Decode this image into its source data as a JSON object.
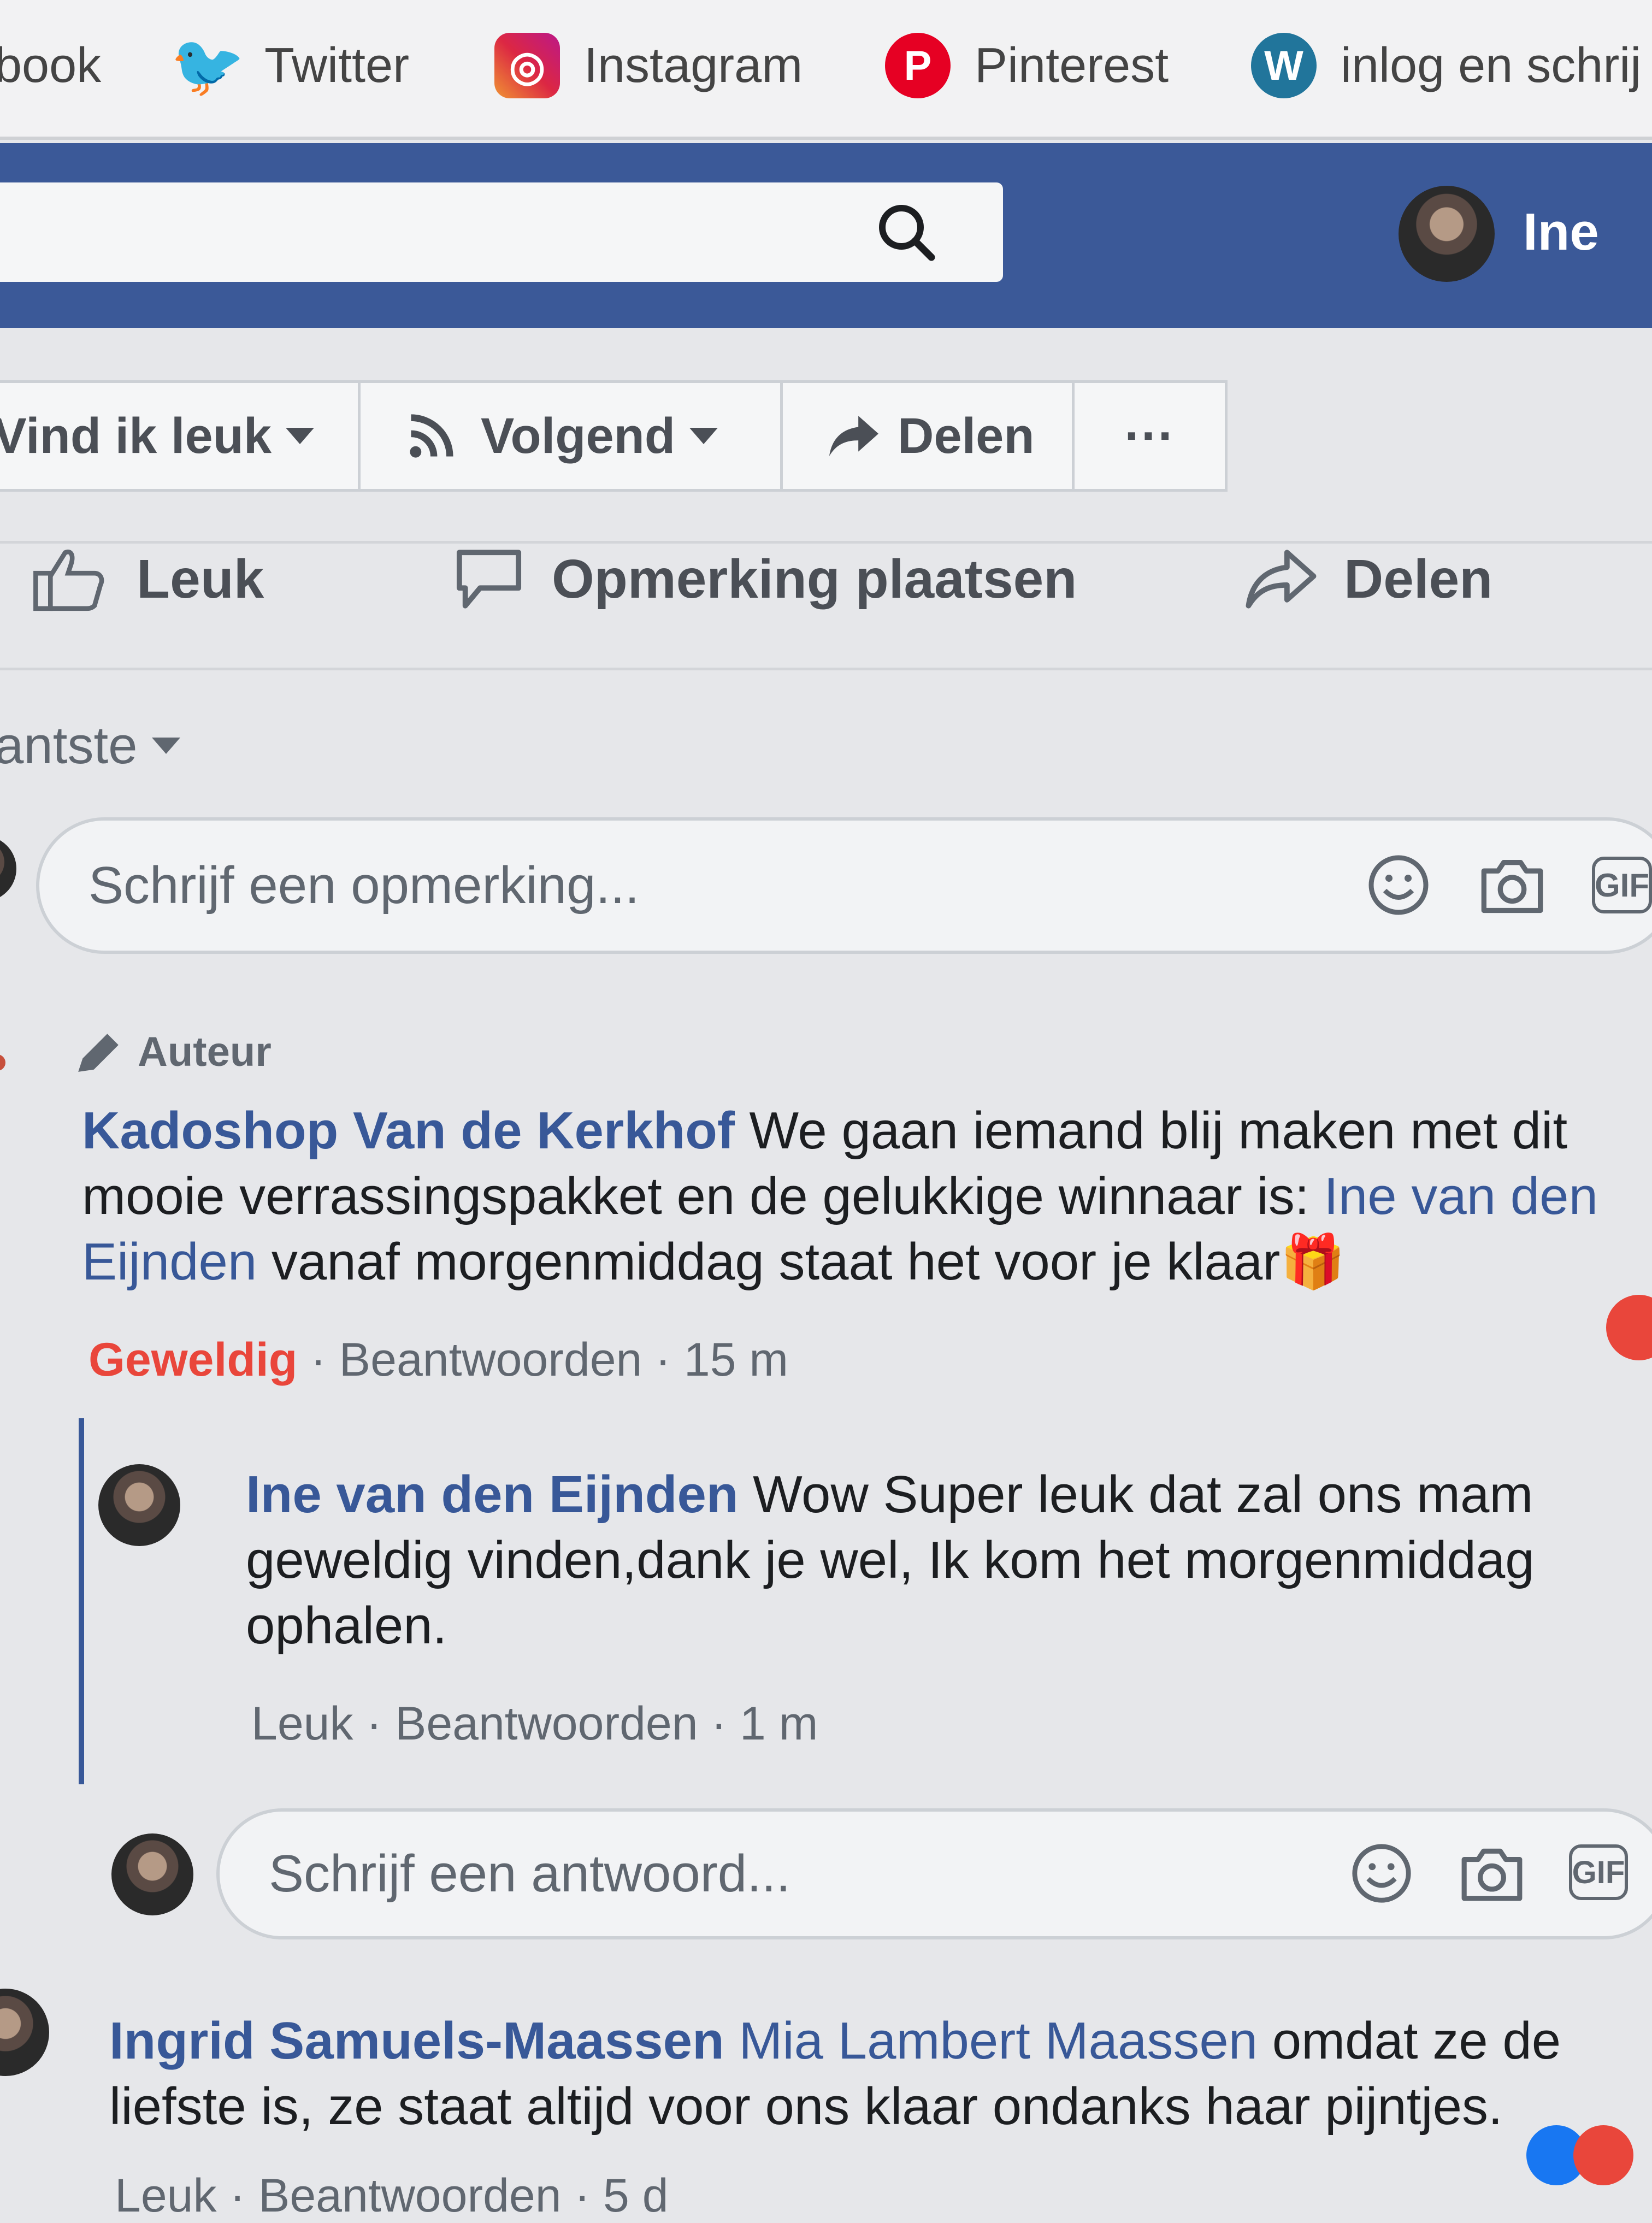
{
  "bookmarks": [
    {
      "label": "book",
      "icon": "facebook-icon"
    },
    {
      "label": "Twitter",
      "icon": "twitter-icon"
    },
    {
      "label": "Instagram",
      "icon": "instagram-icon"
    },
    {
      "label": "Pinterest",
      "icon": "pinterest-icon"
    },
    {
      "label": "inlog en schrij",
      "icon": "wordpress-icon"
    }
  ],
  "header": {
    "user_name": "Ine",
    "brand_color": "#3b5998"
  },
  "page_buttons": {
    "like": "Vind ik leuk",
    "follow": "Volgend",
    "share": "Delen",
    "more": "···"
  },
  "actions": {
    "like": "Leuk",
    "comment": "Opmerking plaatsen",
    "share": "Delen"
  },
  "sort": {
    "label": "antste"
  },
  "comment_input": {
    "placeholder": "Schrijf een opmerking...",
    "gif": "GIF"
  },
  "comments": [
    {
      "badge": "Auteur",
      "author": "Kadoshop Van de Kerkhof",
      "text_1": " We gaan iemand blij maken met dit mooie verrassingspakket en de gelukkige winnaar is: ",
      "mention": "Ine van den Eijnden",
      "text_2": " vanaf morgenmiddag staat het voor je klaar",
      "emoji": "🎁",
      "reaction": "Geweldig",
      "reply": "Beantwoorden",
      "time": "15 m"
    },
    {
      "author": "Ine van den Eijnden",
      "text": " Wow Super leuk dat zal ons mam geweldig vinden,dank je wel, Ik kom het morgenmiddag ophalen.",
      "like": "Leuk",
      "reply": "Beantwoorden",
      "time": "1 m"
    },
    {
      "author": "Ingrid Samuels-Maassen",
      "mention": "Mia Lambert Maassen",
      "text": " omdat ze de liefste is, ze staat altijd voor ons klaar ondanks haar pijntjes.",
      "like": "Leuk",
      "reply": "Beantwoorden",
      "time": "5 d"
    }
  ],
  "reply_input": {
    "placeholder": "Schrijf een antwoord...",
    "gif": "GIF"
  },
  "separator": "·"
}
